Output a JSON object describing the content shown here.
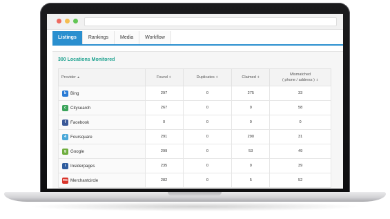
{
  "tabs": [
    {
      "label": "Listings",
      "active": true
    },
    {
      "label": "Rankings",
      "active": false
    },
    {
      "label": "Media",
      "active": false
    },
    {
      "label": "Workflow",
      "active": false
    }
  ],
  "panel": {
    "title": "300 Locations Monitored"
  },
  "table": {
    "headers": {
      "provider": "Provider",
      "found": "Found",
      "duplicates": "Duplicates",
      "claimed": "Claimed",
      "mismatched_line1": "Mismatched",
      "mismatched_line2": "( phone / address )"
    },
    "sort_indicators": {
      "ascending": "▲",
      "sortable": "⇕"
    },
    "rows": [
      {
        "provider": "Bing",
        "icon": "bing-icon",
        "icon_color": "#2a7bd5",
        "found": "297",
        "duplicates": "0",
        "claimed": "275",
        "mismatched": "33"
      },
      {
        "provider": "Citysearch",
        "icon": "citysearch-icon",
        "icon_color": "#3aa35a",
        "found": "267",
        "duplicates": "0",
        "claimed": "0",
        "mismatched": "58"
      },
      {
        "provider": "Facebook",
        "icon": "facebook-icon",
        "icon_color": "#3b5998",
        "found": "0",
        "duplicates": "0",
        "claimed": "0",
        "mismatched": "0"
      },
      {
        "provider": "Foursquare",
        "icon": "foursquare-icon",
        "icon_color": "#4aa8d8",
        "found": "291",
        "duplicates": "0",
        "claimed": "290",
        "mismatched": "31"
      },
      {
        "provider": "Google",
        "icon": "google-icon",
        "icon_color": "#6fae3f",
        "found": "299",
        "duplicates": "0",
        "claimed": "53",
        "mismatched": "49"
      },
      {
        "provider": "Insiderpages",
        "icon": "insiderpages-icon",
        "icon_color": "#2f5d9e",
        "found": "235",
        "duplicates": "0",
        "claimed": "0",
        "mismatched": "39"
      },
      {
        "provider": "Merchantcircle",
        "icon": "merchantcircle-icon",
        "icon_color": "#d9342b",
        "found": "282",
        "duplicates": "0",
        "claimed": "5",
        "mismatched": "52"
      }
    ]
  },
  "colors": {
    "accent": "#2a8fcf",
    "title": "#1aa08d"
  }
}
